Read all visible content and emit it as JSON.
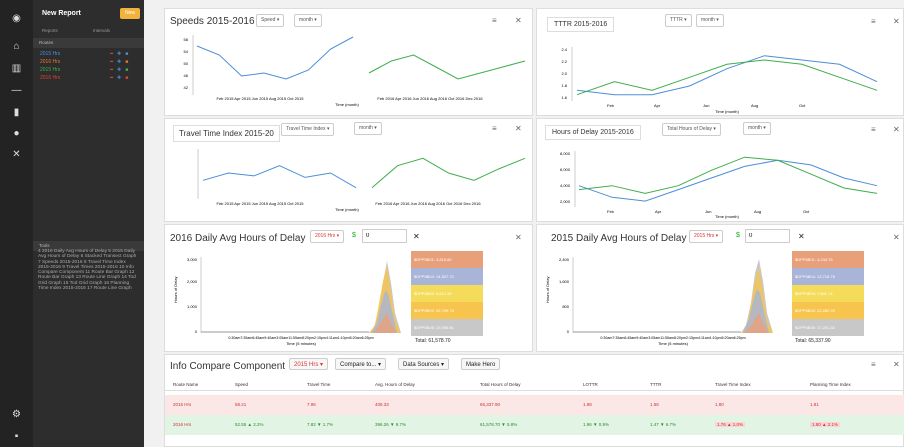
{
  "sidebar": {
    "title": "New Report",
    "new_btn": "New",
    "sub1": "Reports",
    "sub2": "Intervals",
    "routes_hdr": "Routes",
    "routes": [
      {
        "label": "2015 Hrs",
        "color": "#4a8fd8"
      },
      {
        "label": "2016 Hrs",
        "color": "#e8762f"
      },
      {
        "label": "2015 Hrs",
        "color": "#3fae4b"
      },
      {
        "label": "2016 Hrs",
        "color": "#d9453d"
      }
    ],
    "tools_hdr": "Tools",
    "tools_list": "4 2016 Daily Avg Hours of Delay 5 2015 Daily Avg Hours of Delay 6 Stacked Transect Graph 7 Speeds 2015-2016 8 Travel Time Index 2015-2016 9 Travel Times 2015-2016 10 Info Compare Component 11 Route Bar Graph 12 Route Bar Graph 13 Route Line Graph 14 Tod Grid Graph 15 Tod Grid Graph 16 Planning Time Index 2015-2016 17 Route Line Graph"
  },
  "panels": {
    "speeds": {
      "title": "Speeds 2015-2016",
      "dd1": "Speed ▾",
      "dd2": "month ▾",
      "xlabel": "Time (month)"
    },
    "ttr": {
      "title": "TTTR 2015-2016",
      "dd1": "TTTR ▾",
      "dd2": "month ▾",
      "xlabel": "Time (month)"
    },
    "tti": {
      "title": "Travel Time Index 2015-20",
      "dd1": "Travel Time Index ▾",
      "dd2": "month ▾",
      "xlabel": "Time (month)"
    },
    "hod": {
      "title": "Hours of Delay 2015-2016",
      "dd1": "Total Hours of Delay ▾",
      "dd2": "month ▾",
      "xlabel": "Time (month)"
    },
    "daily16": {
      "title": "2016 Daily Avg Hours of Delay",
      "hrs": "2016 Hrs ▾",
      "dollar": "$",
      "val": "0",
      "xlabel": "Time (5 minutes)",
      "total": "Total: 61,578.70",
      "legend": [
        {
          "label": "$DPP5B01: 4,815.80",
          "color": "#e8a07a"
        },
        {
          "label": "$DPP5B04: 14,527.72",
          "color": "#a8b4d8"
        },
        {
          "label": "$DPP5B03: 5,612.35",
          "color": "#f4dc5a"
        },
        {
          "label": "$DPP5B02: 32,709.76",
          "color": "#f7c44e"
        },
        {
          "label": "$DPP5B05: 13,095.81",
          "color": "#c8c8c8"
        }
      ]
    },
    "daily15": {
      "title": "2015 Daily Avg Hours of Delay",
      "hrs": "2015 Hrs ▾",
      "dollar": "$",
      "val": "0",
      "xlabel": "Time (5 minutes)",
      "total": "Total: 65,337.90",
      "legend": [
        {
          "label": "$DPP5B01: 4,243.75",
          "color": "#e8a07a"
        },
        {
          "label": "$DPP5B04: 13,718.76",
          "color": "#a8b4d8"
        },
        {
          "label": "$DPP5B03: 7,801.74",
          "color": "#f4dc5a"
        },
        {
          "label": "$DPP5B02: 22,282.39",
          "color": "#f7c44e"
        },
        {
          "label": "$DPP5B05: 17,251.32",
          "color": "#c8c8c8"
        }
      ]
    }
  },
  "info": {
    "title": "Info Compare Component",
    "b1": "2015 Hrs ▾",
    "b2": "Compare to... ▾",
    "b3": "Data Sources ▾",
    "b4": "Make Hero",
    "headers": [
      "Route Name",
      "Speed",
      "Travel Time",
      "Avg. Hours of Delay",
      "Total Hours of Delay",
      "LOTTR",
      "TTTR",
      "Travel Time Index",
      "Planning Time Index"
    ],
    "row1": [
      "2015 Hrs",
      "58.21",
      "7.96",
      "408.33",
      "65,337.90",
      "1.98",
      "1.58",
      "1.80",
      "1.81"
    ],
    "row2": [
      "2016 Hrs",
      "52.55 ▲ 2.2%",
      "7.82 ▼ 1.7%",
      "396.26 ▼ 9.7%",
      "61,578.70 ▼ 5.8%",
      "1.96 ▼ 0.9%",
      "1.47 ▼ 6.7%",
      "1.76 ▲ 1.0%",
      "1.80 ▲ 2.1%"
    ]
  },
  "chart_data": [
    {
      "type": "line",
      "title": "Speeds 2015-2016",
      "series": [
        {
          "values": [
            55,
            52,
            45,
            46,
            44,
            47,
            54,
            58
          ]
        },
        {
          "values": [
            46,
            50,
            52,
            48,
            44,
            46,
            48,
            50
          ]
        }
      ],
      "ylim": [
        40,
        58
      ]
    },
    {
      "type": "line",
      "title": "TTTR 2015-2016",
      "series": [
        {
          "values": [
            1.6,
            1.5,
            1.5,
            1.7,
            2.1,
            2.4,
            2.3,
            2.2,
            1.8
          ]
        },
        {
          "values": [
            1.5,
            1.8,
            1.6,
            1.9,
            2.2,
            2.3,
            2.2,
            1.9,
            1.6
          ]
        }
      ],
      "ylim": [
        1.4,
        2.6
      ]
    },
    {
      "type": "line",
      "title": "Travel Time Index 2015-20",
      "series": [
        {
          "values": [
            1.4,
            1.45,
            1.43,
            1.5,
            1.42,
            1.45,
            1.35
          ]
        },
        {
          "values": [
            1.35,
            1.5,
            1.55,
            1.45,
            1.4,
            1.48,
            1.55
          ]
        }
      ]
    },
    {
      "type": "line",
      "title": "Hours of Delay 2015-2016",
      "series": [
        {
          "values": [
            4500,
            3000,
            2500,
            4000,
            5500,
            7000,
            7800,
            7200,
            5500,
            4500
          ]
        },
        {
          "values": [
            4000,
            4500,
            3500,
            4500,
            6500,
            8200,
            7800,
            6000,
            4200,
            3500
          ]
        }
      ],
      "ylim": [
        2000,
        9000
      ]
    }
  ]
}
